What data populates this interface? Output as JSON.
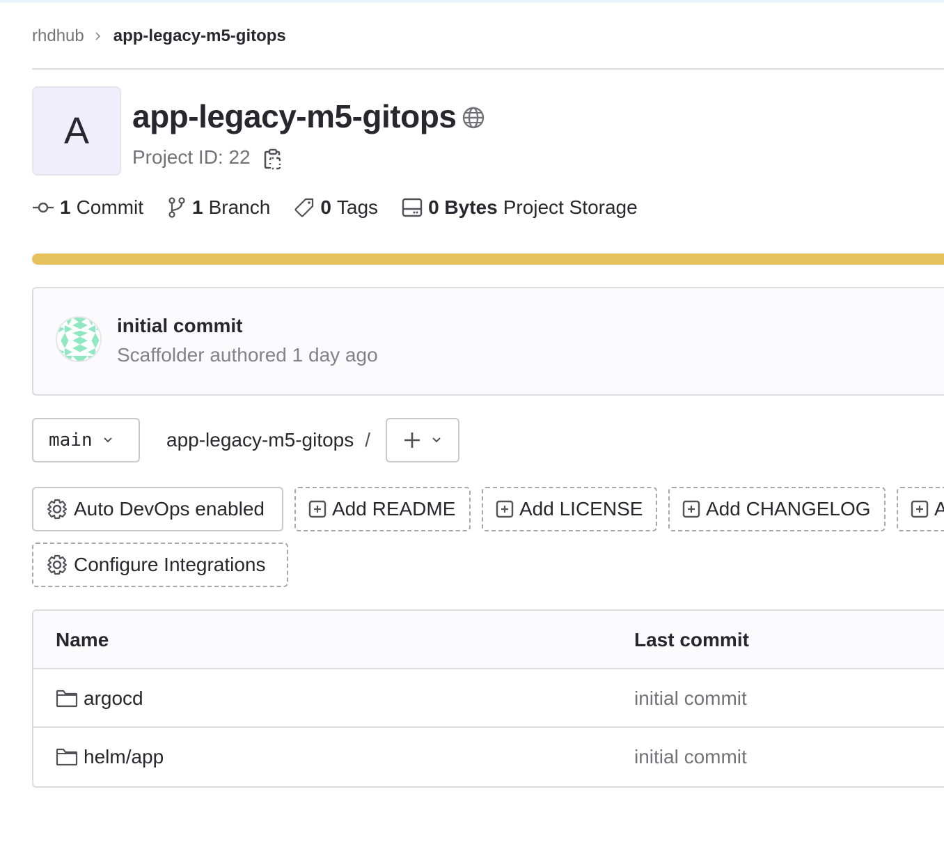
{
  "breadcrumb": {
    "parent": "rhdhub",
    "current": "app-legacy-m5-gitops"
  },
  "project": {
    "avatar_letter": "A",
    "title": "app-legacy-m5-gitops",
    "visibility_icon": "globe-icon",
    "id_label": "Project ID: 22"
  },
  "stats": {
    "commits": {
      "count": "1",
      "label": "Commit",
      "icon": "commit-icon"
    },
    "branches": {
      "count": "1",
      "label": "Branch",
      "icon": "branch-icon"
    },
    "tags": {
      "count": "0",
      "label": "Tags",
      "icon": "tag-icon"
    },
    "storage": {
      "count": "0 Bytes",
      "label": "Project Storage",
      "icon": "storage-icon"
    }
  },
  "language_bar": {
    "color": "#e6c15b",
    "fraction": 1.0
  },
  "last_commit": {
    "title": "initial commit",
    "meta": "Scaffolder authored 1 day ago"
  },
  "ref": {
    "branch": "main",
    "path_root": "app-legacy-m5-gitops",
    "path_sep": "/"
  },
  "actions": {
    "auto_devops": "Auto DevOps enabled",
    "add_readme": "Add README",
    "add_license": "Add LICENSE",
    "add_changelog": "Add CHANGELOG",
    "add_partial": "A",
    "configure_integrations": "Configure Integrations"
  },
  "file_table": {
    "columns": [
      "Name",
      "Last commit"
    ],
    "rows": [
      {
        "name": "argocd",
        "type": "folder",
        "last_commit": "initial commit"
      },
      {
        "name": "helm/app",
        "type": "folder",
        "last_commit": "initial commit"
      }
    ]
  }
}
